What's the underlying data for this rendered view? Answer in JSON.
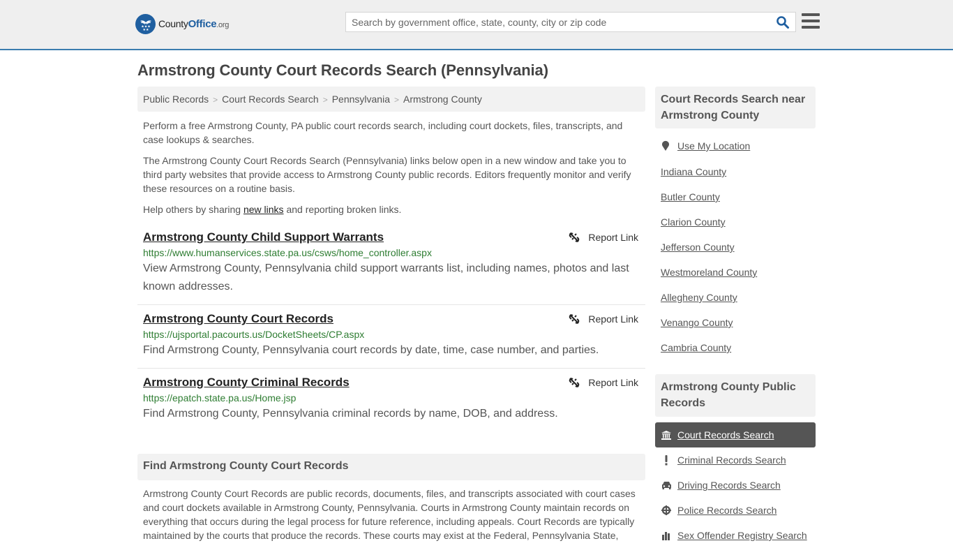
{
  "header": {
    "logo": {
      "county": "County",
      "office": "Office",
      "org": ".org"
    },
    "search": {
      "placeholder": "Search by government office, state, county, city or zip code",
      "value": ""
    },
    "accent_color": "#1f5fa0",
    "border_color": "#3a7cae"
  },
  "page": {
    "title": "Armstrong County Court Records Search (Pennsylvania)",
    "breadcrumb": [
      "Public Records",
      "Court Records Search",
      "Pennsylvania",
      "Armstrong County"
    ],
    "intro": {
      "p1": "Perform a free Armstrong County, PA public court records search, including court dockets, files, transcripts, and case lookups & searches.",
      "p2": "The Armstrong County Court Records Search (Pennsylvania) links below open in a new window and take you to third party websites that provide access to Armstrong County public records. Editors frequently monitor and verify these resources on a routine basis.",
      "p3_before": "Help others by sharing ",
      "p3_link": "new links",
      "p3_after": " and reporting broken links."
    },
    "listings": [
      {
        "title": "Armstrong County Child Support Warrants",
        "url": "https://www.humanservices.state.pa.us/csws/home_controller.aspx",
        "description": "View Armstrong County, Pennsylvania child support warrants list, including names, photos and last known addresses.",
        "report_label": "Report Link"
      },
      {
        "title": "Armstrong County Court Records",
        "url": "https://ujsportal.pacourts.us/DocketSheets/CP.aspx",
        "description": "Find Armstrong County, Pennsylvania court records by date, time, case number, and parties.",
        "report_label": "Report Link"
      },
      {
        "title": "Armstrong County Criminal Records",
        "url": "https://epatch.state.pa.us/Home.jsp",
        "description": "Find Armstrong County, Pennsylvania criminal records by name, DOB, and address.",
        "report_label": "Report Link"
      }
    ],
    "find_section": {
      "heading": "Find Armstrong County Court Records",
      "body": "Armstrong County Court Records are public records, documents, files, and transcripts associated with court cases and court dockets available in Armstrong County, Pennsylvania. Courts in Armstrong County maintain records on everything that occurs during the legal process for future reference, including appeals. Court Records are typically maintained by the courts that produce the records. These courts may exist at the Federal, Pennsylvania State,"
    }
  },
  "sidebar": {
    "nearby": {
      "heading": "Court Records Search near Armstrong County",
      "use_location": "Use My Location",
      "counties": [
        "Indiana County",
        "Butler County",
        "Clarion County",
        "Jefferson County",
        "Westmoreland County",
        "Allegheny County",
        "Venango County",
        "Cambria County"
      ]
    },
    "public_records": {
      "heading": "Armstrong County Public Records",
      "items": [
        {
          "label": "Court Records Search",
          "icon": "courthouse-icon",
          "active": true
        },
        {
          "label": "Criminal Records Search",
          "icon": "exclamation-icon",
          "active": false
        },
        {
          "label": "Driving Records Search",
          "icon": "car-icon",
          "active": false
        },
        {
          "label": "Police Records Search",
          "icon": "crosshair-icon",
          "active": false
        },
        {
          "label": "Sex Offender Registry Search",
          "icon": "city-icon",
          "active": false
        }
      ]
    }
  }
}
